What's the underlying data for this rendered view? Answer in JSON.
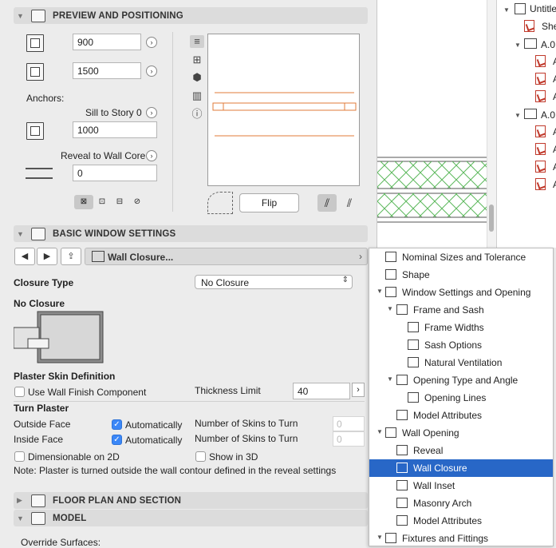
{
  "preview_section": {
    "title": "PREVIEW AND POSITIONING",
    "width_value": "900",
    "height_value": "1500",
    "anchors_label": "Anchors:",
    "sill_label": "Sill to Story 0",
    "sill_value": "1000",
    "reveal_label": "Reveal to Wall Core",
    "reveal_value": "0",
    "flip_label": "Flip"
  },
  "basic_section": {
    "title": "BASIC WINDOW SETTINGS",
    "page_select_label": "Wall Closure...",
    "closure_type_label": "Closure Type",
    "closure_type_value": "No Closure",
    "closure_caption": "No Closure",
    "plaster_heading": "Plaster Skin Definition",
    "use_wall_finish_label": "Use Wall Finish Component",
    "thickness_limit_label": "Thickness Limit",
    "thickness_limit_value": "40",
    "turn_plaster_heading": "Turn Plaster",
    "outside_face_label": "Outside Face",
    "inside_face_label": "Inside Face",
    "automatically_label": "Automatically",
    "skins_label": "Number of Skins to Turn",
    "skins_outside_value": "0",
    "skins_inside_value": "0",
    "dimensionable_label": "Dimensionable on 2D",
    "show_3d_label": "Show in 3D",
    "note": "Note: Plaster is turned outside the wall contour defined in the reveal settings"
  },
  "floor_plan_section": {
    "title": "FLOOR PLAN AND SECTION"
  },
  "model_section": {
    "title": "MODEL",
    "override_label": "Override Surfaces:"
  },
  "tree": {
    "root": "Untitle",
    "child": "She",
    "group1": "A.0",
    "group2": "A.0",
    "item": "A"
  },
  "menu": {
    "items": [
      "Nominal Sizes and Tolerance",
      "Shape",
      "Window Settings and Opening",
      "Frame and Sash",
      "Frame Widths",
      "Sash Options",
      "Natural Ventilation",
      "Opening Type and Angle",
      "Opening Lines",
      "Model Attributes",
      "Wall Opening",
      "Reveal",
      "Wall Closure",
      "Wall Inset",
      "Masonry Arch",
      "Model Attributes",
      "Fixtures and Fittings"
    ],
    "selected": "Wall Closure"
  },
  "colors": {
    "accent": "#2867c7",
    "checkbox_on": "#3b87f7",
    "preview_line": "#e07b39",
    "hatch": "#5cb85c",
    "pdf": "#c0392b"
  }
}
